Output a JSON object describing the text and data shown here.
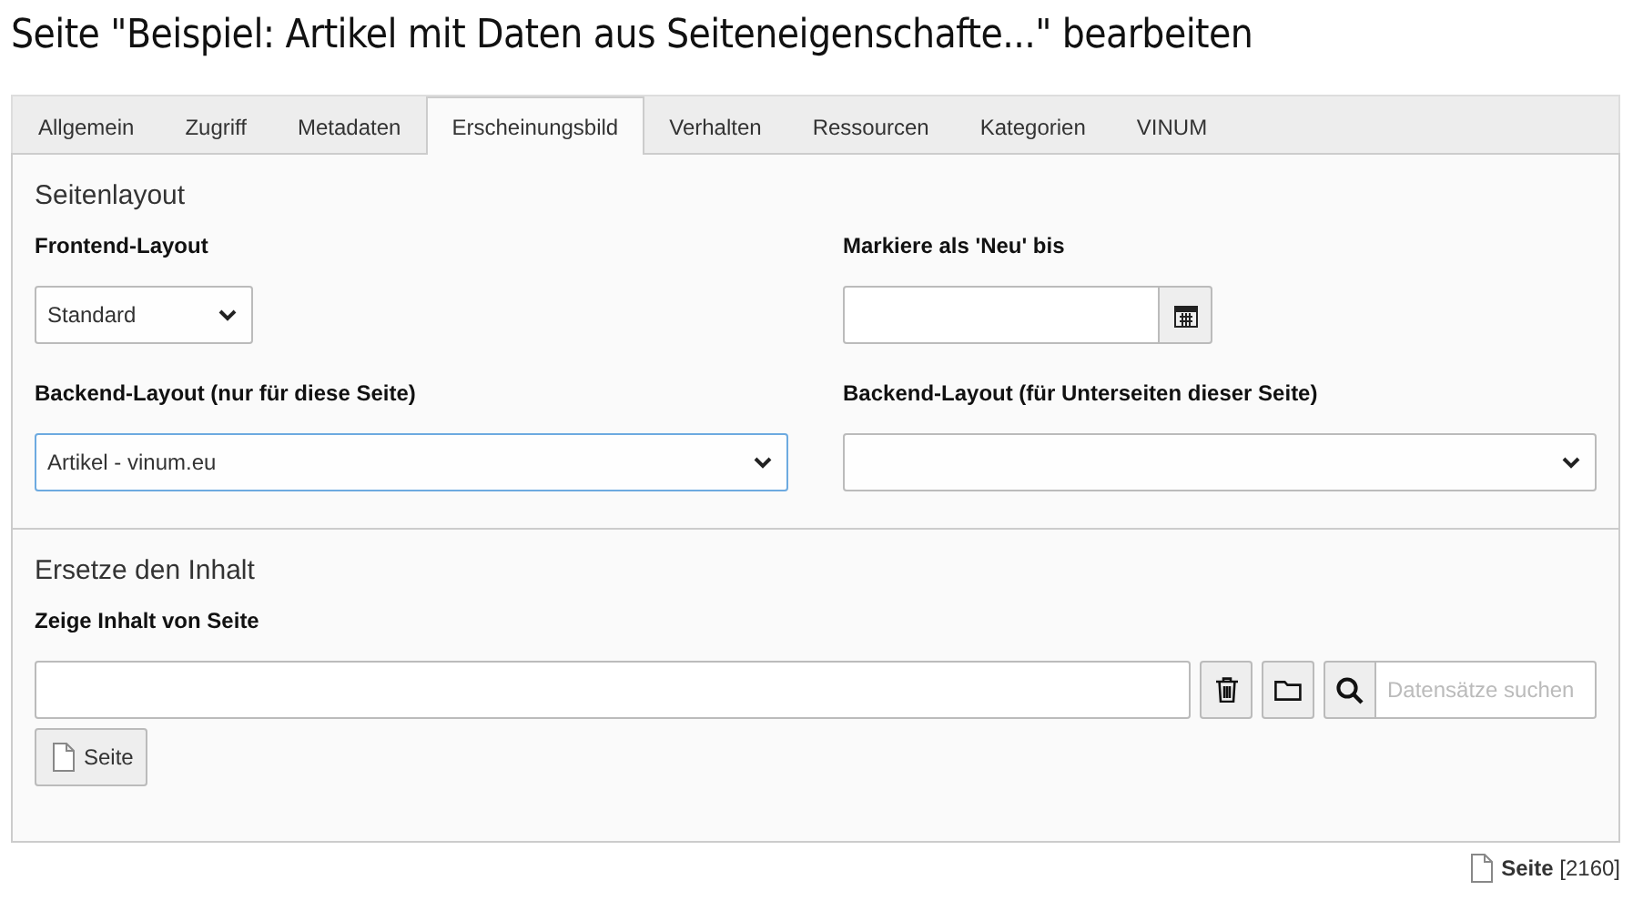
{
  "title": "Seite \"Beispiel: Artikel mit Daten aus Seiteneigenschafte...\" bearbeiten",
  "tabs": [
    {
      "label": "Allgemein",
      "selected": false
    },
    {
      "label": "Zugriff",
      "selected": false
    },
    {
      "label": "Metadaten",
      "selected": false
    },
    {
      "label": "Erscheinungsbild",
      "selected": true
    },
    {
      "label": "Verhalten",
      "selected": false
    },
    {
      "label": "Ressourcen",
      "selected": false
    },
    {
      "label": "Kategorien",
      "selected": false
    },
    {
      "label": "VINUM",
      "selected": false
    }
  ],
  "layout_section": {
    "heading": "Seitenlayout",
    "fields": [
      {
        "kind": "select",
        "label": "Frontend-Layout",
        "value": "Standard",
        "focused": false,
        "narrow": true
      },
      {
        "kind": "date",
        "label": "Markiere als 'Neu' bis"
      },
      {
        "kind": "select",
        "label": "Backend-Layout (nur für diese Seite)",
        "value": "Artikel - vinum.eu",
        "focused": true,
        "narrow": false
      },
      {
        "kind": "select",
        "label": "Backend-Layout (für Unterseiten dieser Seite)",
        "focused": false,
        "narrow": false
      }
    ]
  },
  "content_section": {
    "heading": "Ersetze den Inhalt",
    "label": "Zeige Inhalt von Seite",
    "search_placeholder": "Datensätze suchen",
    "add_button": "Seite"
  },
  "footer": "**Seite** [2160]"
}
